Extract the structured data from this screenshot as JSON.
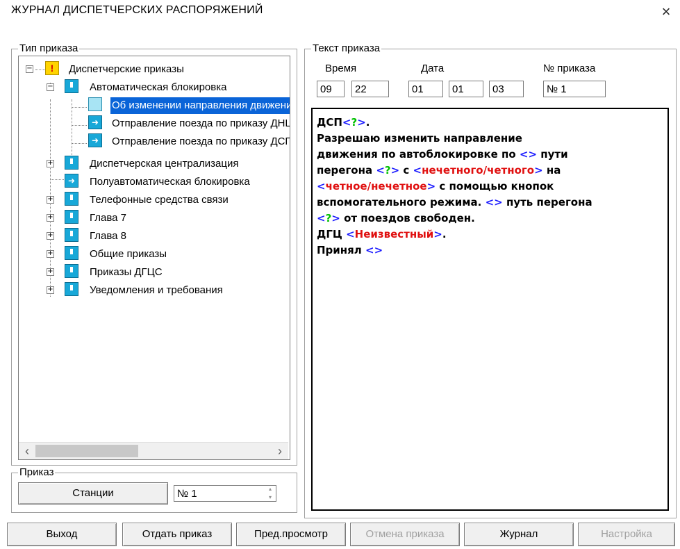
{
  "window": {
    "title": "ЖУРНАЛ ДИСПЕТЧЕРСКИХ РАСПОРЯЖЕНИЙ",
    "close_glyph": "×"
  },
  "order_type": {
    "legend": "Тип приказа",
    "tree": [
      {
        "label": "Диспетчерские приказы",
        "icon": "warning-icon",
        "expander": "−"
      },
      {
        "label": "Автоматическая блокировка",
        "icon": "folder-icon",
        "expander": "−"
      },
      {
        "label": "Об изменении направления движения",
        "icon": "book-icon",
        "selected": true
      },
      {
        "label": "Отправление поезда по приказу ДНЦ",
        "icon": "arrow-icon"
      },
      {
        "label": "Отправление поезда по приказу ДСП",
        "icon": "arrow-icon"
      },
      {
        "label": "Диспетчерская централизация",
        "icon": "folder-icon",
        "expander": "+"
      },
      {
        "label": "Полуавтоматическая блокировка",
        "icon": "arrow-icon"
      },
      {
        "label": "Телефонные средства связи",
        "icon": "folder-icon",
        "expander": "+"
      },
      {
        "label": "Глава 7",
        "icon": "folder-icon",
        "expander": "+"
      },
      {
        "label": "Глава 8",
        "icon": "folder-icon",
        "expander": "+"
      },
      {
        "label": "Общие приказы",
        "icon": "folder-icon",
        "expander": "+"
      },
      {
        "label": "Приказы ДГЦС",
        "icon": "folder-icon",
        "expander": "+"
      },
      {
        "label": "Уведомления и требования",
        "icon": "folder-icon",
        "expander": "+"
      }
    ],
    "scroll_left": "‹",
    "scroll_right": "›"
  },
  "order": {
    "legend": "Приказ",
    "stations_button": "Станции",
    "number_value": "№ 1"
  },
  "order_text": {
    "legend": "Текст приказа",
    "time_label": "Время",
    "date_label": "Дата",
    "number_label": "№ приказа",
    "hour": "09",
    "minute": "22",
    "day": "01",
    "month": "01",
    "year": "03",
    "number": "№ 1",
    "segments": [
      {
        "t": "ДСП",
        "c": ""
      },
      {
        "t": "<",
        "c": "blue"
      },
      {
        "t": "?",
        "c": "green"
      },
      {
        "t": ">",
        "c": "blue"
      },
      {
        "t": ".",
        "c": ""
      },
      {
        "br": true
      },
      {
        "t": "Разрешаю изменить направление",
        "c": ""
      },
      {
        "br": true
      },
      {
        "t": "движения по автоблокировке по ",
        "c": ""
      },
      {
        "t": "<>",
        "c": "blue"
      },
      {
        "t": " пути",
        "c": ""
      },
      {
        "br": true
      },
      {
        "t": "перегона ",
        "c": ""
      },
      {
        "t": "<",
        "c": "blue"
      },
      {
        "t": "?",
        "c": "green"
      },
      {
        "t": ">",
        "c": "blue"
      },
      {
        "t": " с ",
        "c": ""
      },
      {
        "t": "<",
        "c": "blue"
      },
      {
        "t": "нечетного/четного",
        "c": "red"
      },
      {
        "t": ">",
        "c": "blue"
      },
      {
        "t": " на",
        "c": ""
      },
      {
        "br": true
      },
      {
        "t": "<",
        "c": "blue"
      },
      {
        "t": "четное/нечетное",
        "c": "red"
      },
      {
        "t": ">",
        "c": "blue"
      },
      {
        "t": " с помощью кнопок",
        "c": ""
      },
      {
        "br": true
      },
      {
        "t": "вспомогательного режима. ",
        "c": ""
      },
      {
        "t": "<>",
        "c": "blue"
      },
      {
        "t": " путь перегона",
        "c": ""
      },
      {
        "br": true
      },
      {
        "t": "<",
        "c": "blue"
      },
      {
        "t": "?",
        "c": "green"
      },
      {
        "t": ">",
        "c": "blue"
      },
      {
        "t": " от поездов свободен.",
        "c": ""
      },
      {
        "br": true
      },
      {
        "t": "ДГЦ ",
        "c": ""
      },
      {
        "t": "<",
        "c": "blue"
      },
      {
        "t": "Неизвестный",
        "c": "red"
      },
      {
        "t": ">",
        "c": "blue"
      },
      {
        "t": ".",
        "c": ""
      },
      {
        "br": true
      },
      {
        "t": "Принял ",
        "c": ""
      },
      {
        "t": "<>",
        "c": "blue"
      }
    ]
  },
  "buttons": {
    "exit": "Выход",
    "give_order": "Отдать приказ",
    "preview": "Пред.просмотр",
    "cancel_order": "Отмена приказа",
    "journal": "Журнал",
    "settings": "Настройка"
  },
  "colors": {
    "selection": "#0a64d8",
    "placeholder": "#1a1aff",
    "value_green": "#00c000",
    "value_red": "#e01010"
  }
}
